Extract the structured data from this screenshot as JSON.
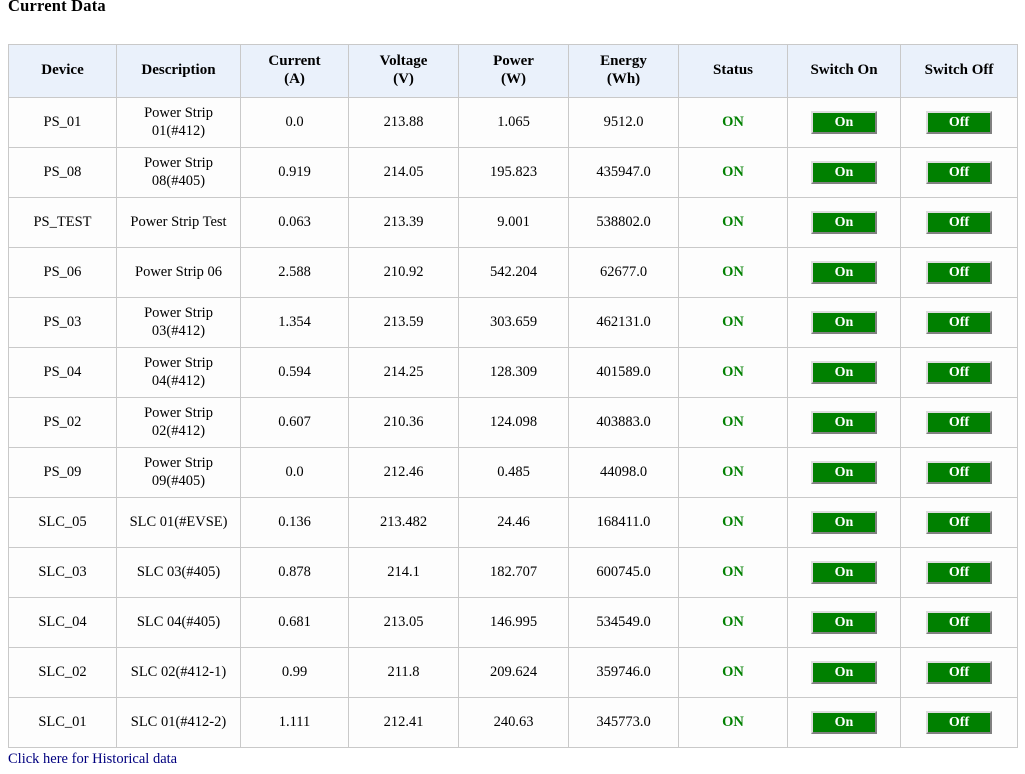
{
  "page": {
    "title": "Current Data"
  },
  "table": {
    "columns": [
      {
        "label": "Device",
        "unit": ""
      },
      {
        "label": "Description",
        "unit": ""
      },
      {
        "label": "Current",
        "unit": "(A)"
      },
      {
        "label": "Voltage",
        "unit": "(V)"
      },
      {
        "label": "Power",
        "unit": "(W)"
      },
      {
        "label": "Energy",
        "unit": "(Wh)"
      },
      {
        "label": "Status",
        "unit": ""
      },
      {
        "label": "Switch On",
        "unit": ""
      },
      {
        "label": "Switch Off",
        "unit": ""
      }
    ],
    "rows": [
      {
        "device": "PS_01",
        "description": "Power Strip 01(#412)",
        "current": "0.0",
        "voltage": "213.88",
        "power": "1.065",
        "energy": "9512.0",
        "status": "ON",
        "on_label": "On",
        "off_label": "Off"
      },
      {
        "device": "PS_08",
        "description": "Power Strip 08(#405)",
        "current": "0.919",
        "voltage": "214.05",
        "power": "195.823",
        "energy": "435947.0",
        "status": "ON",
        "on_label": "On",
        "off_label": "Off"
      },
      {
        "device": "PS_TEST",
        "description": "Power Strip Test",
        "current": "0.063",
        "voltage": "213.39",
        "power": "9.001",
        "energy": "538802.0",
        "status": "ON",
        "on_label": "On",
        "off_label": "Off"
      },
      {
        "device": "PS_06",
        "description": "Power Strip 06",
        "current": "2.588",
        "voltage": "210.92",
        "power": "542.204",
        "energy": "62677.0",
        "status": "ON",
        "on_label": "On",
        "off_label": "Off"
      },
      {
        "device": "PS_03",
        "description": "Power Strip 03(#412)",
        "current": "1.354",
        "voltage": "213.59",
        "power": "303.659",
        "energy": "462131.0",
        "status": "ON",
        "on_label": "On",
        "off_label": "Off"
      },
      {
        "device": "PS_04",
        "description": "Power Strip 04(#412)",
        "current": "0.594",
        "voltage": "214.25",
        "power": "128.309",
        "energy": "401589.0",
        "status": "ON",
        "on_label": "On",
        "off_label": "Off"
      },
      {
        "device": "PS_02",
        "description": "Power Strip 02(#412)",
        "current": "0.607",
        "voltage": "210.36",
        "power": "124.098",
        "energy": "403883.0",
        "status": "ON",
        "on_label": "On",
        "off_label": "Off"
      },
      {
        "device": "PS_09",
        "description": "Power Strip 09(#405)",
        "current": "0.0",
        "voltage": "212.46",
        "power": "0.485",
        "energy": "44098.0",
        "status": "ON",
        "on_label": "On",
        "off_label": "Off"
      },
      {
        "device": "SLC_05",
        "description": "SLC 01(#EVSE)",
        "current": "0.136",
        "voltage": "213.482",
        "power": "24.46",
        "energy": "168411.0",
        "status": "ON",
        "on_label": "On",
        "off_label": "Off"
      },
      {
        "device": "SLC_03",
        "description": "SLC 03(#405)",
        "current": "0.878",
        "voltage": "214.1",
        "power": "182.707",
        "energy": "600745.0",
        "status": "ON",
        "on_label": "On",
        "off_label": "Off"
      },
      {
        "device": "SLC_04",
        "description": "SLC 04(#405)",
        "current": "0.681",
        "voltage": "213.05",
        "power": "146.995",
        "energy": "534549.0",
        "status": "ON",
        "on_label": "On",
        "off_label": "Off"
      },
      {
        "device": "SLC_02",
        "description": "SLC 02(#412-1)",
        "current": "0.99",
        "voltage": "211.8",
        "power": "209.624",
        "energy": "359746.0",
        "status": "ON",
        "on_label": "On",
        "off_label": "Off"
      },
      {
        "device": "SLC_01",
        "description": "SLC 01(#412-2)",
        "current": "1.111",
        "voltage": "212.41",
        "power": "240.63",
        "energy": "345773.0",
        "status": "ON",
        "on_label": "On",
        "off_label": "Off"
      }
    ]
  },
  "footer": {
    "historical_link": "Click here for Historical data"
  },
  "colors": {
    "header_bg": "#eaf1fb",
    "cell_bg": "#fdfdfd",
    "border": "#c9c9c9",
    "status_on": "#008000",
    "button_bg": "#008000",
    "button_text": "#ffffff",
    "link": "#00007f"
  }
}
